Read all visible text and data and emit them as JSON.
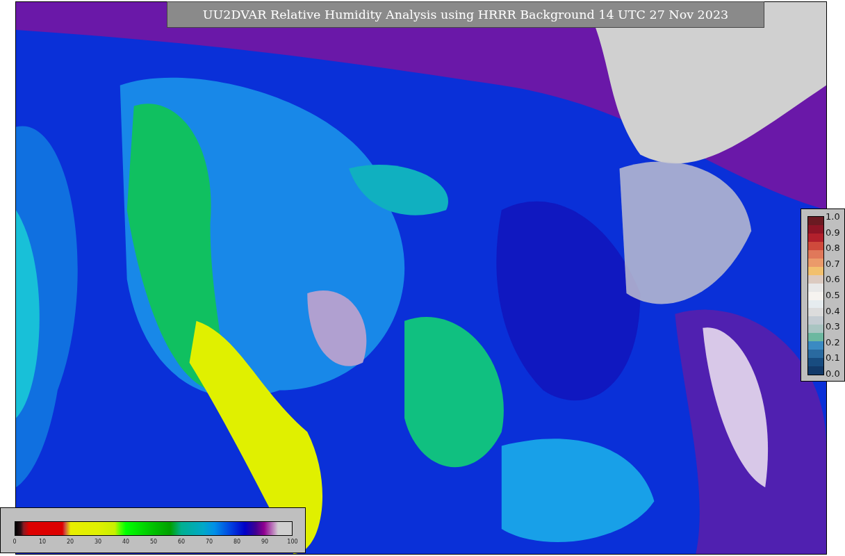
{
  "title": "UU2DVAR Relative Humidity Analysis using HRRR Background 14 UTC 27 Nov 2023",
  "obs_colorbar": {
    "ticks": [
      "1.0",
      "0.9",
      "0.8",
      "0.7",
      "0.6",
      "0.5",
      "0.4",
      "0.3",
      "0.2",
      "0.1",
      "0.0"
    ]
  },
  "rh_colorbar": {
    "ticks": [
      "0",
      "10",
      "20",
      "30",
      "40",
      "50",
      "60",
      "70",
      "80",
      "90",
      "100"
    ]
  }
}
